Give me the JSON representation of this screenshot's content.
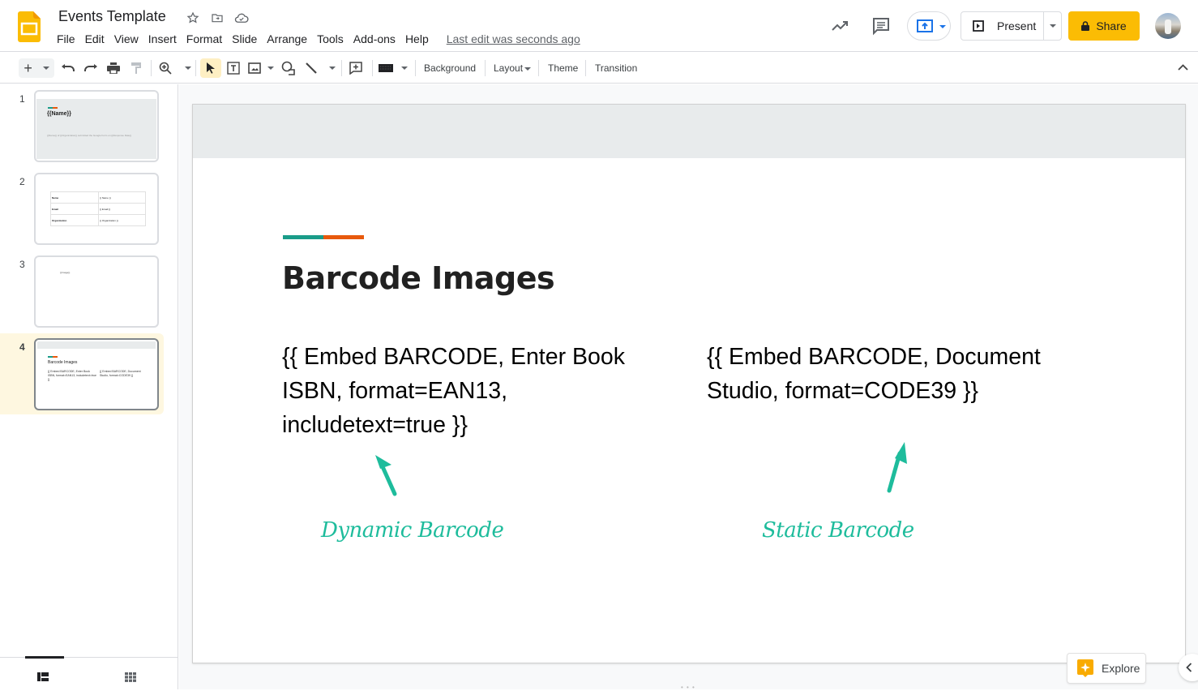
{
  "app": {
    "doc_title": "Events Template",
    "menu": [
      "File",
      "Edit",
      "View",
      "Insert",
      "Format",
      "Slide",
      "Arrange",
      "Tools",
      "Add-ons",
      "Help"
    ],
    "last_edit": "Last edit was seconds ago",
    "present_label": "Present",
    "share_label": "Share",
    "brand_color": "#fbbc04"
  },
  "toolbar": {
    "background_label": "Background",
    "layout_label": "Layout",
    "theme_label": "Theme",
    "transition_label": "Transition"
  },
  "filmstrip": {
    "slides": [
      {
        "number": "1",
        "title": "{{Name}}",
        "subtitle": "{{Name}} of {{Organization}} submitted the Google Form on {{Response Date}}"
      },
      {
        "number": "2",
        "rows": [
          {
            "label": "Name",
            "value": "{{ Name }}"
          },
          {
            "label": "Email",
            "value": "{{ Email }}"
          },
          {
            "label": "Organization",
            "value": "{{ Organization }}"
          }
        ]
      },
      {
        "number": "3",
        "text": "{{Image}}"
      },
      {
        "number": "4",
        "title": "Barcode Images",
        "left": "{{ Embed BARCODE, Enter Book ISBN, format=EAN13, includetext=true }}",
        "right": "{{ Embed BARCODE, Document Studio, format=CODE39 }}"
      }
    ],
    "selected_index": 3
  },
  "slide": {
    "title": "Barcode Images",
    "left_text": "{{ Embed BARCODE, Enter Book ISBN, format=EAN13, includetext=true }}",
    "right_text": "{{ Embed BARCODE, Document Studio, format=CODE39 }}",
    "left_label": "Dynamic Barcode",
    "right_label": "Static Barcode",
    "accent_colors": [
      "#1a9c89",
      "#e8590c"
    ],
    "annotation_color": "#1ebc9c"
  },
  "explore_label": "Explore"
}
